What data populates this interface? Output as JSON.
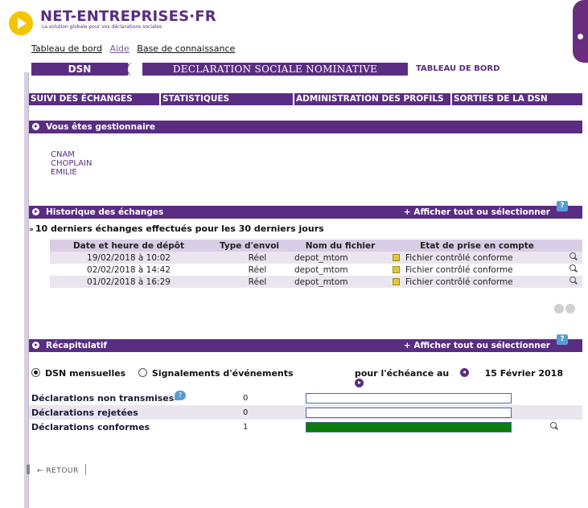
{
  "brand": {
    "title": "NET-ENTREPRISES·FR",
    "subtitle": "La solution globale pour vos déclarations sociales"
  },
  "toplinks": [
    "Tableau de bord",
    "Aide",
    "Base de connaissance"
  ],
  "banner": {
    "dsn": "DSN",
    "declaration": "DECLARATION SOCIALE NOMINATIVE",
    "tab": "TABLEAU DE BORD"
  },
  "nav": [
    "SUIVI DES ÉCHANGES",
    "STATISTIQUES",
    "ADMINISTRATION DES PROFILS",
    "SORTIES DE LA DSN"
  ],
  "gestionnaire": {
    "title": "Vous êtes gestionnaire",
    "lines": [
      "CNAM",
      "CHOPLAIN",
      "EMILIE"
    ]
  },
  "historique": {
    "title": "Historique des échanges",
    "link": "+ Afficher tout ou sélectionner",
    "help": "?",
    "subtitle": "10 derniers échanges effectués pour les 30 derniers jours",
    "columns": [
      "Date et heure de dépôt",
      "Type d'envoi",
      "Nom du fichier",
      "Etat de prise en compte"
    ],
    "rows": [
      {
        "date": "19/02/2018 à 10:02",
        "type": "Réel",
        "file": "depot_mtom",
        "state": "Fichier contrôlé conforme"
      },
      {
        "date": "02/02/2018 à 14:42",
        "type": "Réel",
        "file": "depot_mtom",
        "state": "Fichier contrôlé conforme"
      },
      {
        "date": "01/02/2018 à 16:29",
        "type": "Réel",
        "file": "depot_mtom",
        "state": "Fichier contrôlé conforme"
      }
    ]
  },
  "recap": {
    "title": "Récapitulatif",
    "link": "+ Afficher tout ou sélectionner",
    "help": "?",
    "radio1": "DSN mensuelles",
    "radio2": "Signalements d'événements",
    "echeance_label": "pour l'échéance au",
    "echeance_date": "15 Février 2018",
    "rows": [
      {
        "label": "Déclarations non transmises",
        "count": "0",
        "fill": 0
      },
      {
        "label": "Déclarations rejetées",
        "count": "0",
        "fill": 0
      },
      {
        "label": "Déclarations conformes",
        "count": "1",
        "fill": 1
      }
    ],
    "row_help": "?"
  },
  "retour": "← RETOUR",
  "colors": {
    "purple": "#5a2d82",
    "lavender": "#d9cde6",
    "green": "#0a7d0a",
    "yellow": "#f5c400"
  }
}
